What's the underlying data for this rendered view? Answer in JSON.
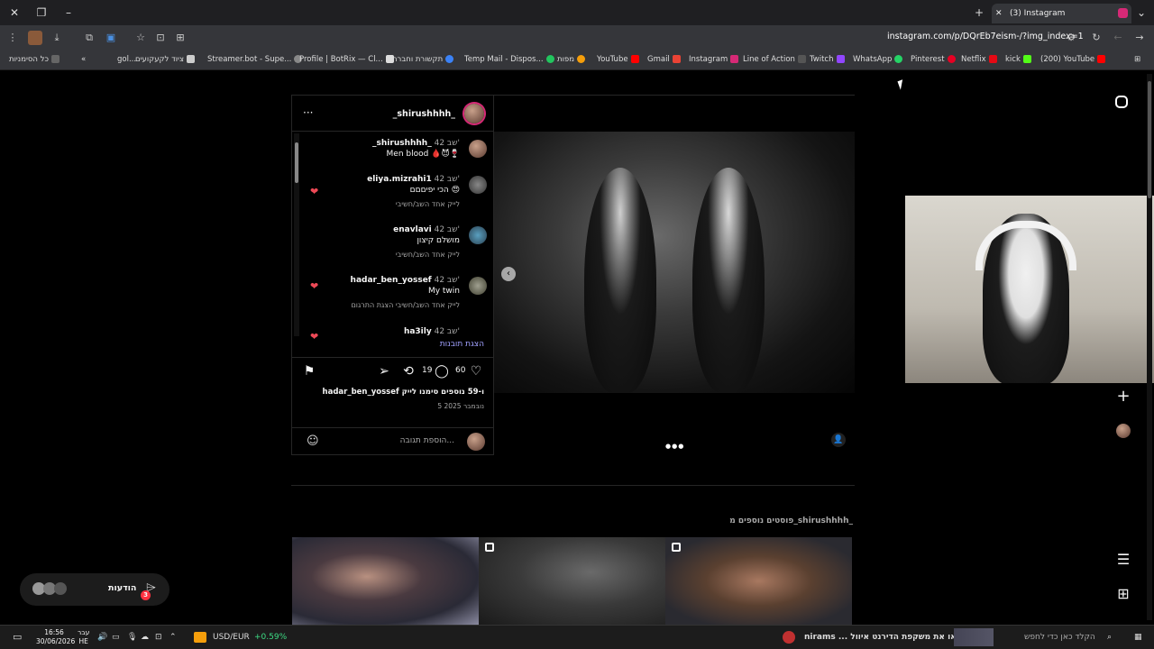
{
  "browser": {
    "tab_title": "(3) Instagram",
    "url": "instagram.com/p/DQrEb7eism-/?img_index=1",
    "bookmarks": [
      {
        "label": "כל הסימניות",
        "color": "#888888"
      },
      {
        "label": "gol...",
        "color": "#aaaaaa"
      },
      {
        "label": "ציוד לקעקועים",
        "color": "#cccccc"
      },
      {
        "label": "Streamer.bot - Supe...",
        "color": "#888888"
      },
      {
        "label": "Profile | BotRix — Cl...",
        "color": "#dddddd"
      },
      {
        "label": "תקשורת וחברה",
        "color": "#3b82f6"
      },
      {
        "label": "Temp Mail - Dispos...",
        "color": "#22c55e"
      },
      {
        "label": "מפות",
        "color": "#f59e0b"
      },
      {
        "label": "YouTube",
        "color": "#ff0000"
      },
      {
        "label": "Gmail",
        "color": "#ea4335"
      },
      {
        "label": "Instagram",
        "color": "#d62976"
      },
      {
        "label": "Line of Action",
        "color": "#555555"
      },
      {
        "label": "Twitch",
        "color": "#9146ff"
      },
      {
        "label": "WhatsApp",
        "color": "#25d366"
      },
      {
        "label": "Pinterest",
        "color": "#e60023"
      },
      {
        "label": "Netflix",
        "color": "#e50914"
      },
      {
        "label": "kick",
        "color": "#53fc18"
      },
      {
        "label": "(200) YouTube",
        "color": "#ff0000"
      }
    ]
  },
  "post": {
    "author": "_shirushhhh_",
    "comments": [
      {
        "user": "_shirushhhh_",
        "time": "42 שב'",
        "text": "Men blood 🩸😈🍷",
        "meta": "",
        "liked": false
      },
      {
        "user": "eliya.mizrahi1",
        "time": "42 שב'",
        "text": "הכי יפיםםם 😍",
        "meta": "לייק אחד   השב/חשיבי",
        "liked": true
      },
      {
        "user": "enavlavi",
        "time": "42 שב'",
        "text": "מושלם קיצון",
        "meta": "לייק אחד   השב/חשיבי",
        "liked": true
      },
      {
        "user": "hadar_ben_yossef",
        "time": "42 שב'",
        "text": "My twin",
        "meta": "לייק אחד   השב/חשיבי   הצגת התרגום",
        "liked": true
      },
      {
        "user": "ha3ily",
        "time": "42 שב'",
        "text": "",
        "meta": "",
        "liked": false
      }
    ],
    "show_replies": "הצגת תובנות",
    "likes_count": "60",
    "comments_count": "19",
    "liked_by": "hadar_ben_yossef ו-59 נוספים סימנו לייק",
    "date": "5 נובמבר 2025",
    "add_comment_placeholder": "הוספת תגובה..."
  },
  "more_posts_title": "פוסטים נוספים מ_shirushhhh_",
  "notifications": {
    "label": "הודעות",
    "badge": "3"
  },
  "taskbar": {
    "time": "16:56",
    "date": "30/06/2026",
    "lang_top": "עבר",
    "lang_bottom": "HE",
    "ticker_name": "USD/EUR",
    "ticker_change": "+0.59%",
    "search_placeholder": "הקלד כאן כדי לחפש",
    "news": "nirams ... יאו את משקפת הדירנט איוול"
  },
  "colors": {
    "accent": "#d62976",
    "heart": "#ed4956",
    "link": "#a1a1ff",
    "ticker_up": "#3ddc84"
  }
}
